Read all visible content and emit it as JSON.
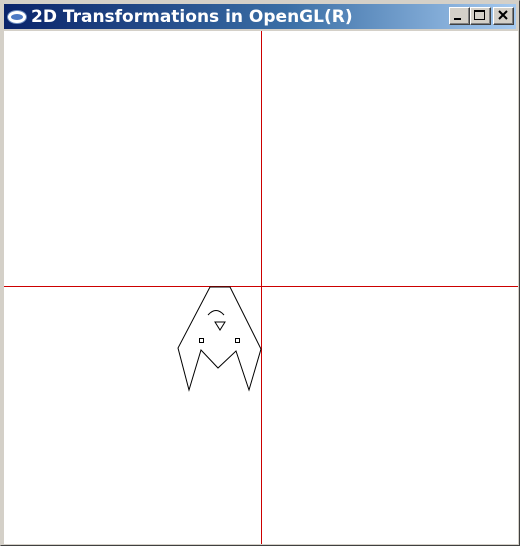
{
  "window": {
    "title": "2D Transformations in OpenGL(R)"
  },
  "icons": {
    "app": "opengl-app-icon",
    "minimize": "minimize-icon",
    "maximize": "maximize-icon",
    "close": "close-icon"
  },
  "colors": {
    "title_gradient_start": "#0a246a",
    "title_gradient_end": "#a6caf0",
    "axis": "#cc0000",
    "shape_stroke": "#000000",
    "canvas_background": "#ffffff"
  }
}
